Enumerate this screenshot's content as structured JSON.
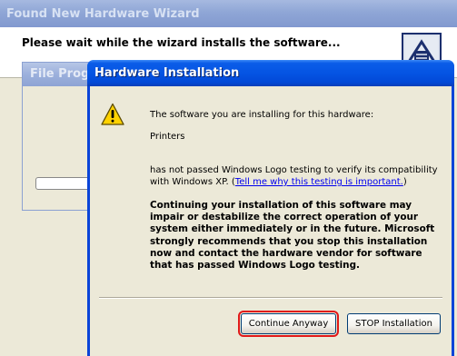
{
  "wizard": {
    "title": "Found New Hardware Wizard",
    "heading": "Please wait while the wizard installs the software..."
  },
  "file_progress": {
    "title": "File Progre"
  },
  "dialog": {
    "title": "Hardware Installation",
    "intro": "The software you are installing for this hardware:",
    "device": "Printers",
    "logo_line1": "has not passed Windows Logo testing to verify its compatibility",
    "logo_line2_prefix": "with Windows XP. (",
    "logo_link": "Tell me why this testing is important.",
    "logo_line2_suffix": ")",
    "warning": "Continuing your installation of this software may impair or destabilize the correct operation of your system either immediately or in the future. Microsoft strongly recommends that you stop this installation now and contact the hardware vendor for software that has passed Windows Logo testing.",
    "buttons": {
      "continue_label": "Continue Anyway",
      "stop_label": "STOP Installation"
    }
  },
  "colors": {
    "titlebar_active": "#0554e3",
    "highlight_outline": "#e01818",
    "link": "#0000ee"
  },
  "icons": {
    "warning": "warning-icon",
    "wizard_logo": "hardware-wizard-icon"
  }
}
